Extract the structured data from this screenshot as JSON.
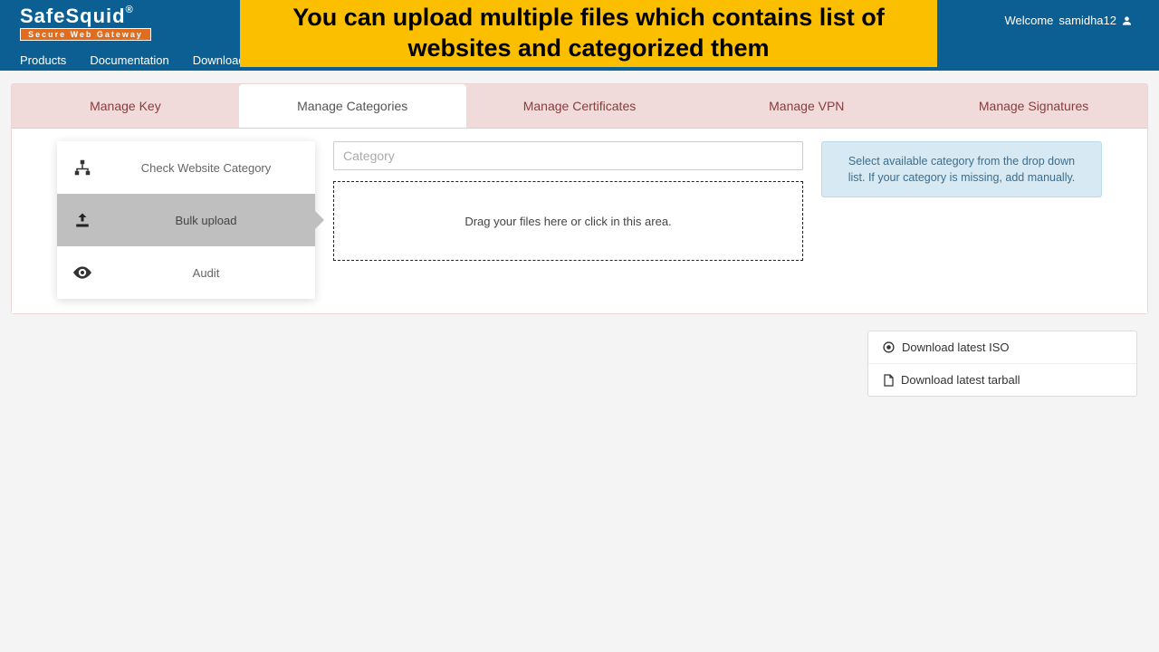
{
  "brand": {
    "name": "SafeSquid",
    "reg": "®",
    "tagline": "Secure Web Gateway"
  },
  "nav": {
    "products": "Products",
    "documentation": "Documentation",
    "downloads": "Downloads"
  },
  "banner": "You can upload multiple files which contains list of websites and categorized them",
  "welcome": {
    "prefix": "Welcome ",
    "user": "samidha12"
  },
  "tabs": {
    "key": "Manage Key",
    "categories": "Manage Categories",
    "certificates": "Manage Certificates",
    "vpn": "Manage VPN",
    "signatures": "Manage Signatures"
  },
  "sidemenu": {
    "check": "Check Website Category",
    "bulk": "Bulk upload",
    "audit": "Audit"
  },
  "category_placeholder": "Category",
  "dropzone_text": "Drag your files here or click in this area.",
  "info_text": "Select available category from the drop down list. If your category is missing, add manually.",
  "downloads": {
    "iso": "Download latest ISO",
    "tarball": "Download latest tarball"
  }
}
